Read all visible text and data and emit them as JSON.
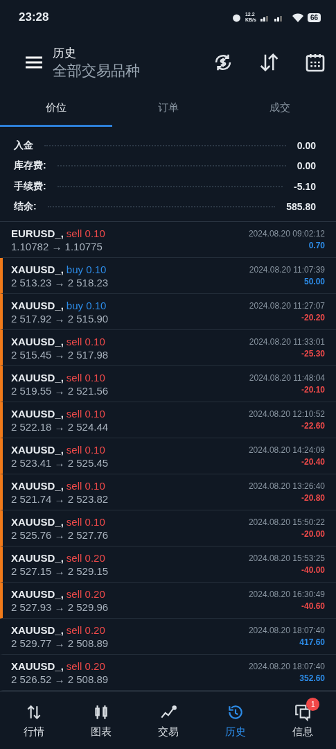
{
  "status_bar": {
    "time": "23:28",
    "speed": "12.2",
    "speed_unit": "KB/s",
    "battery": "66"
  },
  "header": {
    "title": "历史",
    "subtitle": "全部交易品种"
  },
  "tabs": [
    {
      "label": "价位",
      "selected": true
    },
    {
      "label": "订单",
      "selected": false
    },
    {
      "label": "成交",
      "selected": false
    }
  ],
  "summary": [
    {
      "label": "入金",
      "value": "0.00"
    },
    {
      "label": "库存费:",
      "value": "0.00"
    },
    {
      "label": "手续费:",
      "value": "-5.10"
    },
    {
      "label": "结余:",
      "value": "585.80"
    }
  ],
  "trades": [
    {
      "symbol": "EURUSD_,",
      "side": "sell",
      "kind": "sell",
      "volume": "0.10",
      "prices": "1.10782 → 1.10775",
      "time": "2024.08.20 09:02:12",
      "profit": "0.70",
      "loss": false,
      "flagged": false
    },
    {
      "symbol": "XAUUSD_,",
      "side": "buy",
      "kind": "buy",
      "volume": "0.10",
      "prices": "2 513.23 → 2 518.23",
      "time": "2024.08.20 11:07:39",
      "profit": "50.00",
      "loss": false,
      "flagged": true
    },
    {
      "symbol": "XAUUSD_,",
      "side": "buy",
      "kind": "buy",
      "volume": "0.10",
      "prices": "2 517.92 → 2 515.90",
      "time": "2024.08.20 11:27:07",
      "profit": "-20.20",
      "loss": true,
      "flagged": true
    },
    {
      "symbol": "XAUUSD_,",
      "side": "sell",
      "kind": "sell",
      "volume": "0.10",
      "prices": "2 515.45 → 2 517.98",
      "time": "2024.08.20 11:33:01",
      "profit": "-25.30",
      "loss": true,
      "flagged": true
    },
    {
      "symbol": "XAUUSD_,",
      "side": "sell",
      "kind": "sell",
      "volume": "0.10",
      "prices": "2 519.55 → 2 521.56",
      "time": "2024.08.20 11:48:04",
      "profit": "-20.10",
      "loss": true,
      "flagged": true
    },
    {
      "symbol": "XAUUSD_,",
      "side": "sell",
      "kind": "sell",
      "volume": "0.10",
      "prices": "2 522.18 → 2 524.44",
      "time": "2024.08.20 12:10:52",
      "profit": "-22.60",
      "loss": true,
      "flagged": true
    },
    {
      "symbol": "XAUUSD_,",
      "side": "sell",
      "kind": "sell",
      "volume": "0.10",
      "prices": "2 523.41 → 2 525.45",
      "time": "2024.08.20 14:24:09",
      "profit": "-20.40",
      "loss": true,
      "flagged": true
    },
    {
      "symbol": "XAUUSD_,",
      "side": "sell",
      "kind": "sell",
      "volume": "0.10",
      "prices": "2 521.74 → 2 523.82",
      "time": "2024.08.20 13:26:40",
      "profit": "-20.80",
      "loss": true,
      "flagged": true
    },
    {
      "symbol": "XAUUSD_,",
      "side": "sell",
      "kind": "sell",
      "volume": "0.10",
      "prices": "2 525.76 → 2 527.76",
      "time": "2024.08.20 15:50:22",
      "profit": "-20.00",
      "loss": true,
      "flagged": true
    },
    {
      "symbol": "XAUUSD_,",
      "side": "sell",
      "kind": "sell",
      "volume": "0.20",
      "prices": "2 527.15 → 2 529.15",
      "time": "2024.08.20 15:53:25",
      "profit": "-40.00",
      "loss": true,
      "flagged": true
    },
    {
      "symbol": "XAUUSD_,",
      "side": "sell",
      "kind": "sell",
      "volume": "0.20",
      "prices": "2 527.93 → 2 529.96",
      "time": "2024.08.20 16:30:49",
      "profit": "-40.60",
      "loss": true,
      "flagged": true
    },
    {
      "symbol": "XAUUSD_,",
      "side": "sell",
      "kind": "sell",
      "volume": "0.20",
      "prices": "2 529.77 → 2 508.89",
      "time": "2024.08.20 18:07:40",
      "profit": "417.60",
      "loss": false,
      "flagged": false
    },
    {
      "symbol": "XAUUSD_,",
      "side": "sell",
      "kind": "sell",
      "volume": "0.20",
      "prices": "2 526.52 → 2 508.89",
      "time": "2024.08.20 18:07:40",
      "profit": "352.60",
      "loss": false,
      "flagged": false
    }
  ],
  "bottom_nav": [
    {
      "label": "行情",
      "kind": "quotes",
      "selected": false
    },
    {
      "label": "图表",
      "kind": "chart",
      "selected": false
    },
    {
      "label": "交易",
      "kind": "trade",
      "selected": false
    },
    {
      "label": "历史",
      "kind": "history",
      "selected": true
    },
    {
      "label": "信息",
      "kind": "messages",
      "selected": false,
      "badge": "1"
    }
  ]
}
